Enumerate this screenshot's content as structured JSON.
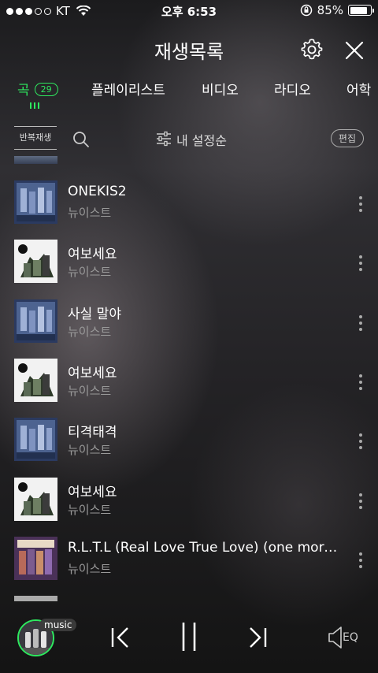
{
  "status_bar": {
    "carrier": "KT",
    "time": "오후 6:53",
    "battery": "85%",
    "battery_level": 0.85
  },
  "header": {
    "title": "재생목록"
  },
  "tabs": [
    {
      "label": "곡",
      "badge": "29",
      "active": true
    },
    {
      "label": "플레이리스트"
    },
    {
      "label": "비디오"
    },
    {
      "label": "라디오"
    },
    {
      "label": "어학"
    }
  ],
  "toolbar": {
    "repeat_label": "반복재생",
    "sort_label": "내 설정순",
    "edit_label": "편집"
  },
  "songs": [
    {
      "title": "ONEKIS2",
      "artist": "뉴이스트",
      "art": "blue"
    },
    {
      "title": "여보세요",
      "artist": "뉴이스트",
      "art": "white"
    },
    {
      "title": "사실 말야",
      "artist": "뉴이스트",
      "art": "blue"
    },
    {
      "title": "여보세요",
      "artist": "뉴이스트",
      "art": "white"
    },
    {
      "title": "티격태격",
      "artist": "뉴이스트",
      "art": "blue"
    },
    {
      "title": "여보세요",
      "artist": "뉴이스트",
      "art": "white"
    },
    {
      "title": "R.L.T.L (Real Love True Love) (one morn...",
      "artist": "뉴이스트",
      "art": "purple"
    }
  ],
  "player": {
    "badge": "music",
    "eq_label": "EQ"
  },
  "colors": {
    "accent": "#2ee85f",
    "text_secondary": "#999999"
  }
}
